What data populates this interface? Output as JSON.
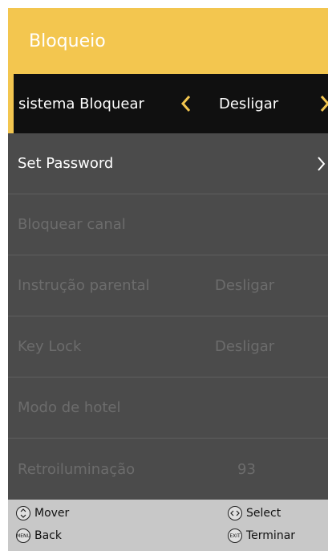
{
  "header": {
    "title": "Bloqueio"
  },
  "menu": [
    {
      "label": "sistema Bloquear",
      "value": "Desligar"
    },
    {
      "label": "Set Password"
    },
    {
      "label": "Bloquear canal"
    },
    {
      "label": "Instrução parental",
      "value": "Desligar"
    },
    {
      "label": "Key Lock",
      "value": "Desligar"
    },
    {
      "label": "Modo de hotel"
    },
    {
      "label": "Retroiluminação",
      "value": "93"
    }
  ],
  "footer": {
    "move": "Mover",
    "select": "Select",
    "back": "Back",
    "exit": "Terminar",
    "menu_key": "MENU",
    "exit_key": "EXIT"
  },
  "colors": {
    "accent": "#f3c64f",
    "panel": "#4b4b4b",
    "selected_row": "#101010",
    "disabled_text": "#6c6c6c",
    "footer": "#c8c8c8"
  },
  "icons": {
    "left": "chevron-left-icon",
    "right": "chevron-right-icon",
    "move": "updown-key-icon",
    "select": "leftright-key-icon",
    "back": "menu-key-icon",
    "exit": "exit-key-icon"
  }
}
